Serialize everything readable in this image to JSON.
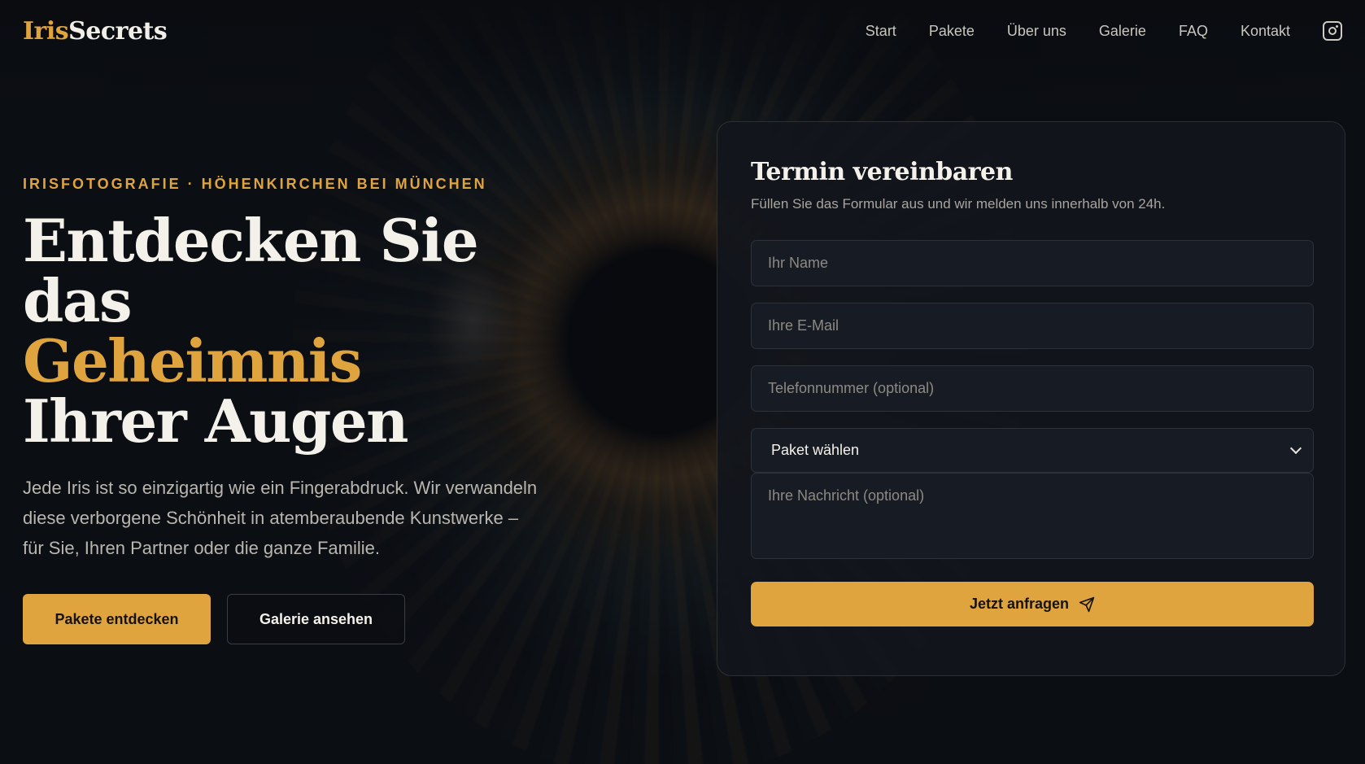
{
  "brand": {
    "part1": "Iris",
    "part2": "Secrets"
  },
  "nav": {
    "items": [
      {
        "label": "Start"
      },
      {
        "label": "Pakete"
      },
      {
        "label": "Über uns"
      },
      {
        "label": "Galerie"
      },
      {
        "label": "FAQ"
      },
      {
        "label": "Kontakt"
      }
    ],
    "instagram_icon": "instagram-icon"
  },
  "hero": {
    "eyebrow": "IRISFOTOGRAFIE · HÖHENKIRCHEN BEI MÜNCHEN",
    "title_line1": "Entdecken Sie das",
    "title_highlight": "Geheimnis",
    "title_line3": "Ihrer Augen",
    "lead": "Jede Iris ist so einzigartig wie ein Fingerabdruck. Wir verwandeln diese verborgene Schönheit in atemberaubende Kunstwerke – für Sie, Ihren Partner oder die ganze Familie.",
    "primary_cta": "Pakete entdecken",
    "secondary_cta": "Galerie ansehen"
  },
  "form": {
    "title": "Termin vereinbaren",
    "subtitle": "Füllen Sie das Formular aus und wir melden uns innerhalb von 24h.",
    "name_placeholder": "Ihr Name",
    "email_placeholder": "Ihre E-Mail",
    "phone_placeholder": "Telefonnummer (optional)",
    "package_selected": "Paket wählen",
    "message_placeholder": "Ihre Nachricht (optional)",
    "submit_label": "Jetzt anfragen",
    "submit_icon": "send-icon"
  },
  "colors": {
    "accent": "#e0a43e",
    "background": "#0d1016",
    "card": "#12151c"
  }
}
